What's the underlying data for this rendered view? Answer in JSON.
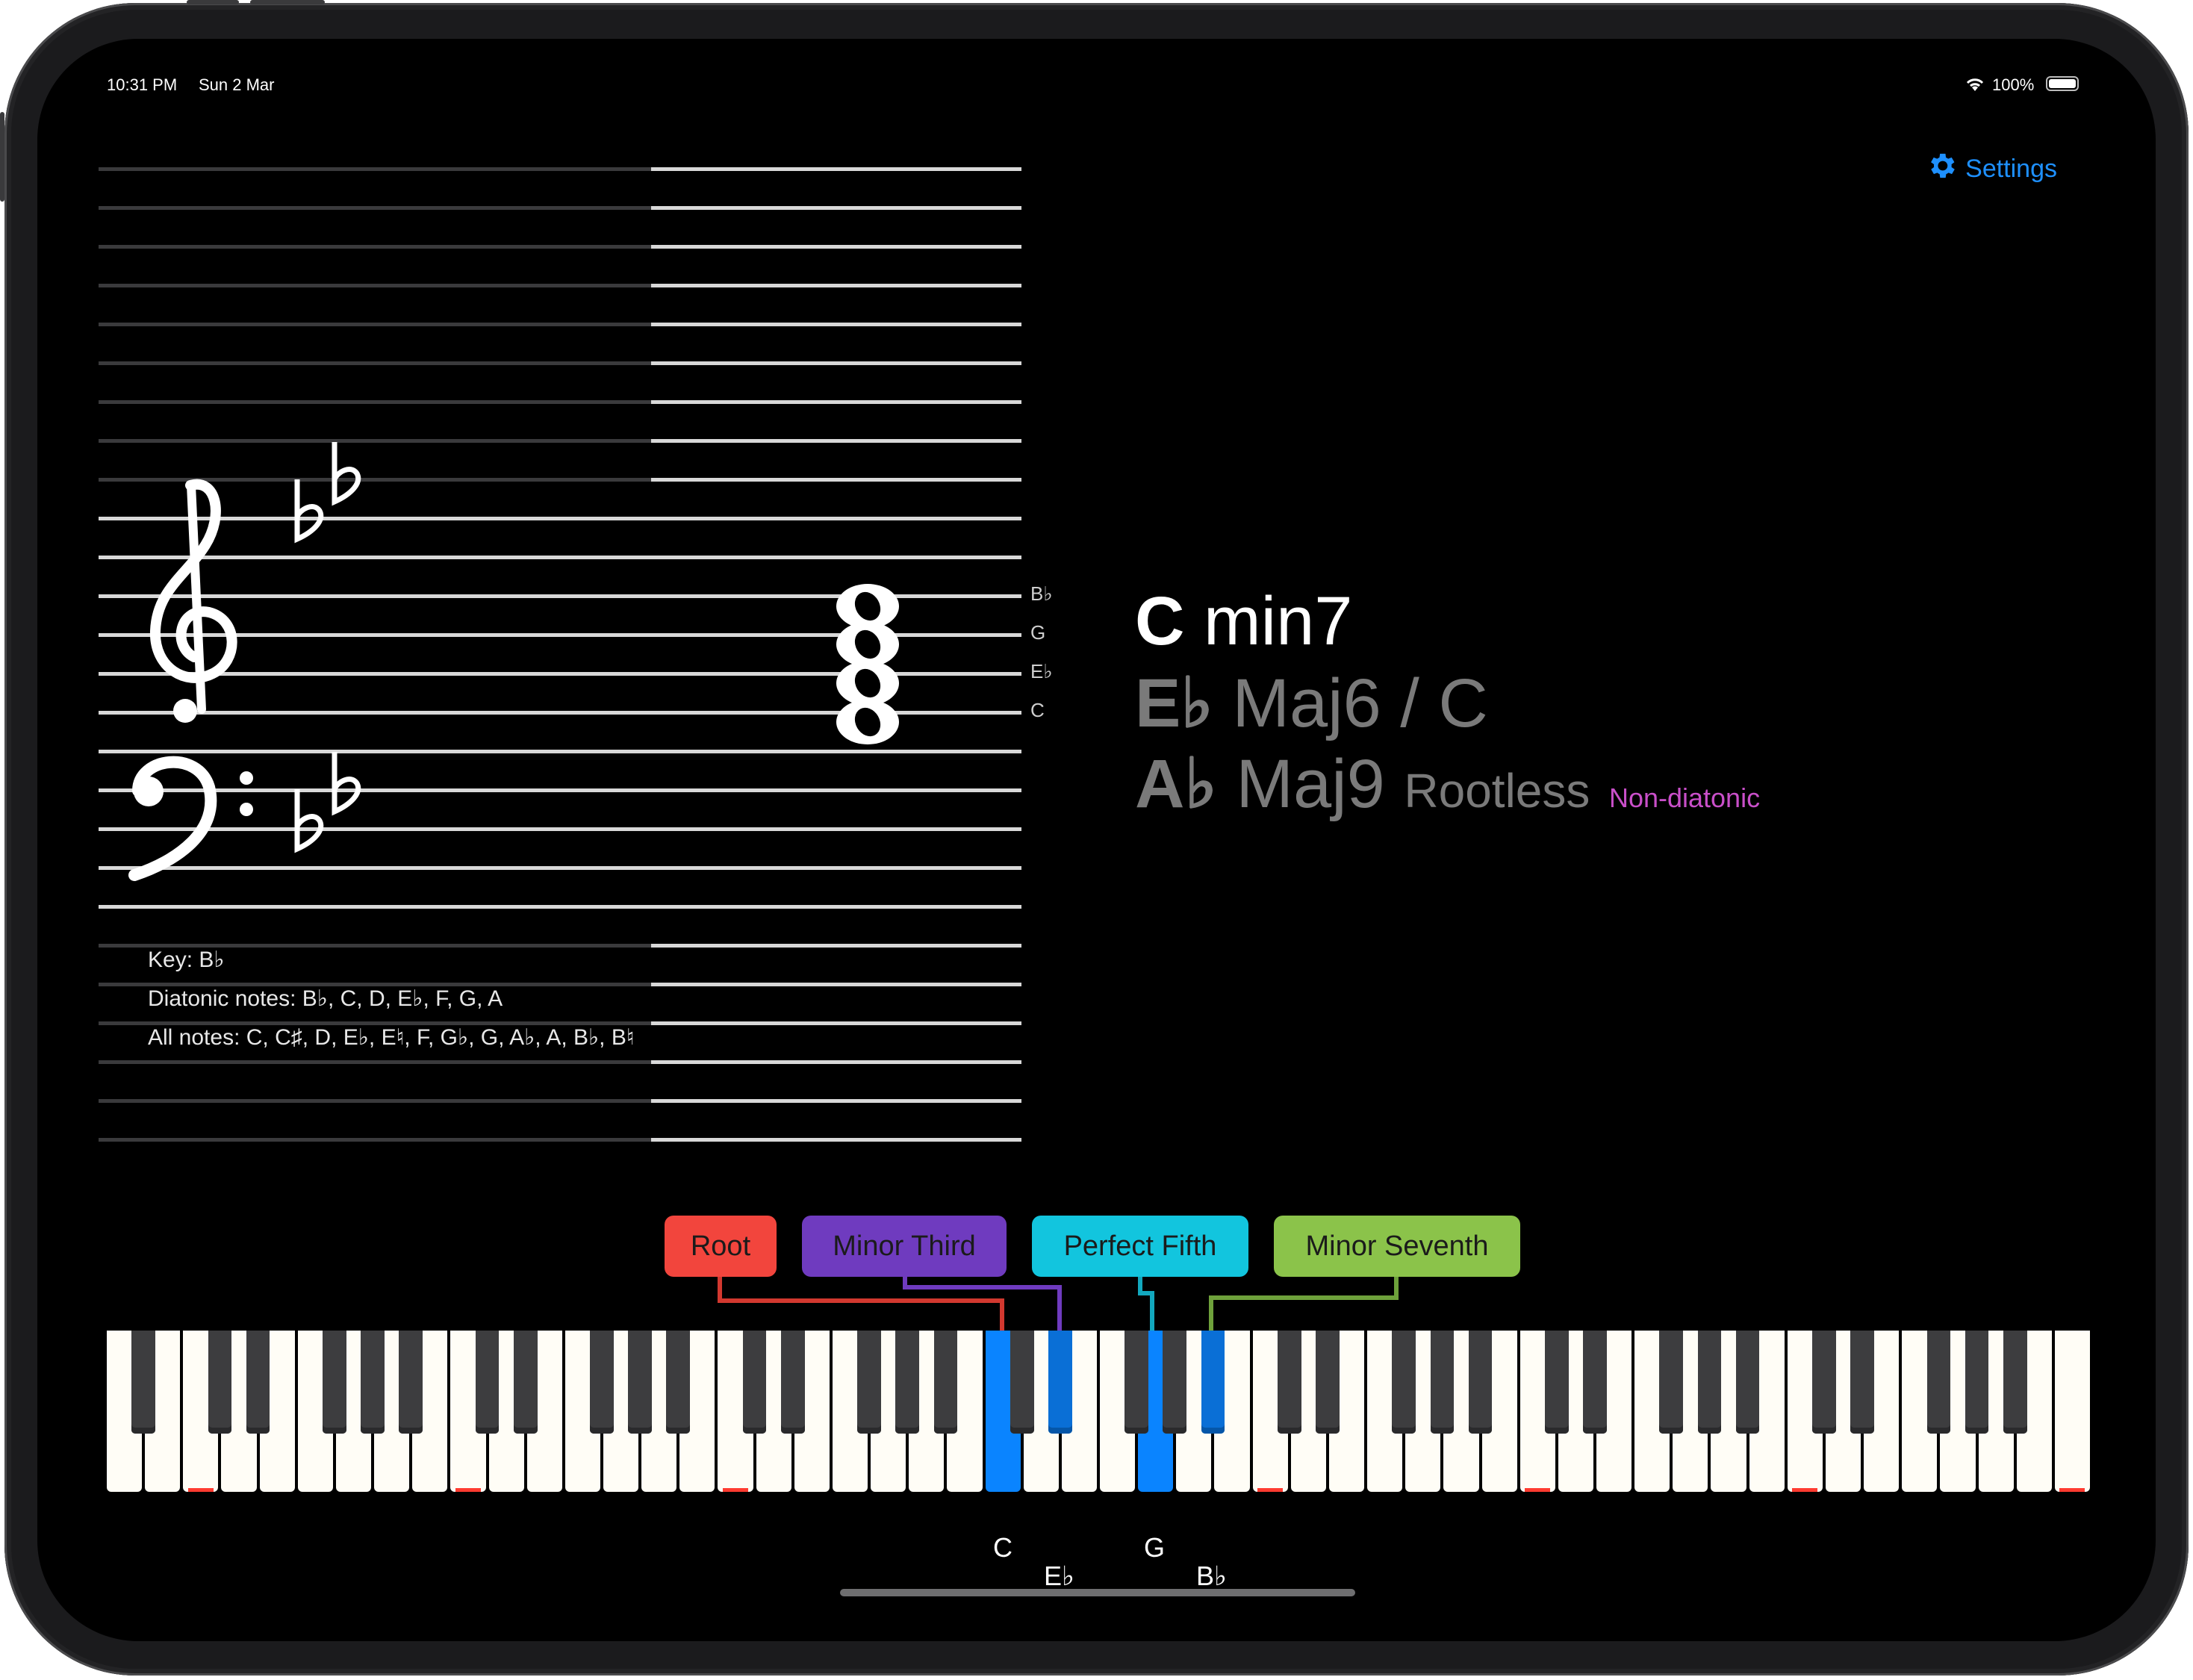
{
  "status_bar": {
    "time": "10:31 PM",
    "date": "Sun 2 Mar",
    "battery": "100%"
  },
  "settings": {
    "label": "Settings",
    "icon": "gear-icon"
  },
  "staff": {
    "chord_note_labels": [
      "B♭",
      "G",
      "E♭",
      "C"
    ],
    "info": {
      "key": "Key: B♭",
      "diatonic": "Diatonic notes: B♭, C, D, E♭, F, G, A",
      "all": "All notes: C, C♯, D, E♭, E♮, F, G♭, G, A♭, A, B♭, B♮"
    }
  },
  "chord": {
    "main_root": "C",
    "main_quality": "min7",
    "alt1_root": "E♭",
    "alt1_quality": "Maj6 / C",
    "alt2_root": "A♭",
    "alt2_quality": "Maj9",
    "alt2_voicing": "Rootless",
    "alt2_tag": "Non-diatonic"
  },
  "legend": [
    {
      "label": "Root",
      "color": "#f2453d"
    },
    {
      "label": "Minor Third",
      "color": "#6f3bbf"
    },
    {
      "label": "Perfect Fifth",
      "color": "#12c5de"
    },
    {
      "label": "Minor Seventh",
      "color": "#8bc34a"
    }
  ],
  "keyboard": {
    "highlighted_notes": [
      "C",
      "E♭",
      "G",
      "B♭"
    ],
    "labels": {
      "c": "C",
      "eb": "E♭",
      "g": "G",
      "bb": "B♭"
    }
  }
}
